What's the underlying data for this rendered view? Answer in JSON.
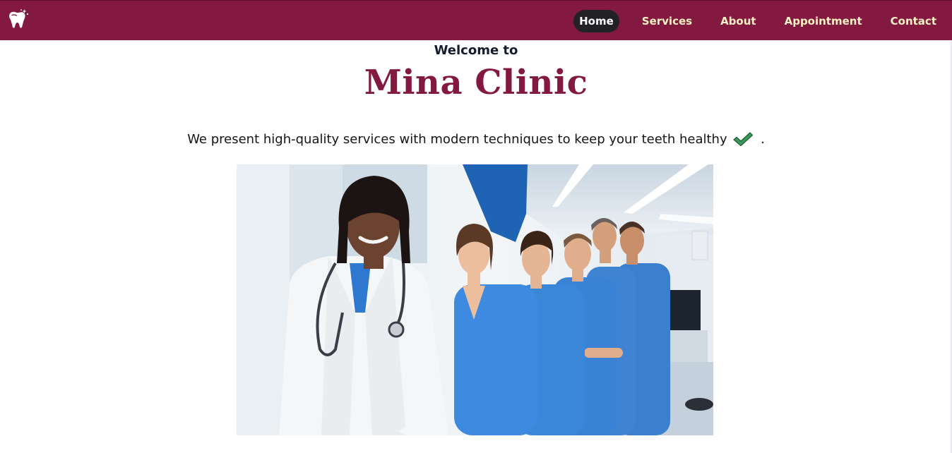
{
  "nav": {
    "logo_icon": "tooth-sparkle-icon",
    "links": [
      {
        "label": "Home",
        "active": true
      },
      {
        "label": "Services",
        "active": false
      },
      {
        "label": "About",
        "active": false
      },
      {
        "label": "Appointment",
        "active": false
      },
      {
        "label": "Contact",
        "active": false
      }
    ]
  },
  "hero": {
    "welcome": "Welcome to",
    "title": "Mina Clinic",
    "tagline": "We present high-quality services with modern techniques to keep your teeth healthy",
    "tagline_end": ".",
    "check_icon": "check-mark-icon",
    "photo_icon": "dental-team-photo"
  },
  "colors": {
    "brand": "#831840",
    "nav_text": "#fff3c4",
    "active_pill": "#222126",
    "check": "#3a9a5b"
  }
}
